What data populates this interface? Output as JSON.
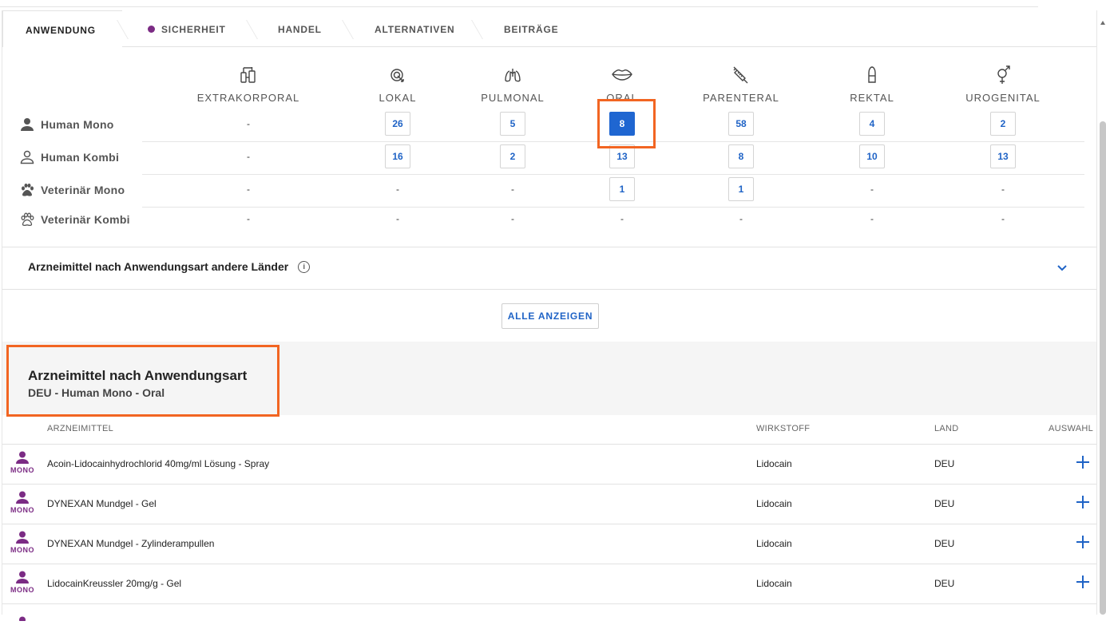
{
  "tabs": [
    {
      "label": "ANWENDUNG",
      "active": true
    },
    {
      "label": "SICHERHEIT",
      "dot": true
    },
    {
      "label": "HANDEL"
    },
    {
      "label": "ALTERNATIVEN"
    },
    {
      "label": "BEITRÄGE"
    }
  ],
  "routes": [
    {
      "label": "EXTRAKORPORAL",
      "icon": "extracorporeal-icon"
    },
    {
      "label": "LOKAL",
      "icon": "local-touch-icon"
    },
    {
      "label": "PULMONAL",
      "icon": "lungs-icon"
    },
    {
      "label": "ORAL",
      "icon": "lips-icon"
    },
    {
      "label": "PARENTERAL",
      "icon": "syringe-icon"
    },
    {
      "label": "REKTAL",
      "icon": "suppository-icon"
    },
    {
      "label": "UROGENITAL",
      "icon": "gender-icon"
    }
  ],
  "rows": [
    {
      "label": "Human Mono",
      "icon": "person-filled-icon",
      "cells": [
        "-",
        "26",
        "5",
        "8",
        "58",
        "4",
        "2"
      ]
    },
    {
      "label": "Human Kombi",
      "icon": "person-outline-icon",
      "cells": [
        "-",
        "16",
        "2",
        "13",
        "8",
        "10",
        "13"
      ]
    },
    {
      "label": "Veterinär Mono",
      "icon": "paw-filled-icon",
      "cells": [
        "-",
        "-",
        "-",
        "1",
        "1",
        "-",
        "-"
      ]
    },
    {
      "label": "Veterinär Kombi",
      "icon": "paw-outline-icon",
      "cells": [
        "-",
        "-",
        "-",
        "-",
        "-",
        "-",
        "-"
      ]
    }
  ],
  "selected_cell": {
    "row": 0,
    "col": 3
  },
  "other_countries": {
    "label": "Arzneimittel nach Anwendungsart andere Länder",
    "info_glyph": "i"
  },
  "show_all_label": "ALLE ANZEIGEN",
  "results": {
    "title": "Arzneimittel nach Anwendungsart",
    "subtitle": "DEU - Human Mono - Oral",
    "columns": {
      "name": "ARZNEIMITTEL",
      "substance": "WIRKSTOFF",
      "country": "LAND",
      "select": "AUSWAHL"
    },
    "badge": "MONO",
    "items": [
      {
        "name": "Acoin-Lidocainhydrochlorid 40mg/ml Lösung - Spray",
        "substance": "Lidocain",
        "country": "DEU"
      },
      {
        "name": "DYNEXAN Mundgel - Gel",
        "substance": "Lidocain",
        "country": "DEU"
      },
      {
        "name": "DYNEXAN Mundgel - Zylinderampullen",
        "substance": "Lidocain",
        "country": "DEU"
      },
      {
        "name": "LidocainKreussler 20mg/g - Gel",
        "substance": "Lidocain",
        "country": "DEU"
      }
    ]
  },
  "colors": {
    "accent": "#1f63c6",
    "selected": "#1f66d1",
    "highlight": "#f26522",
    "mono": "#7b2b84"
  }
}
